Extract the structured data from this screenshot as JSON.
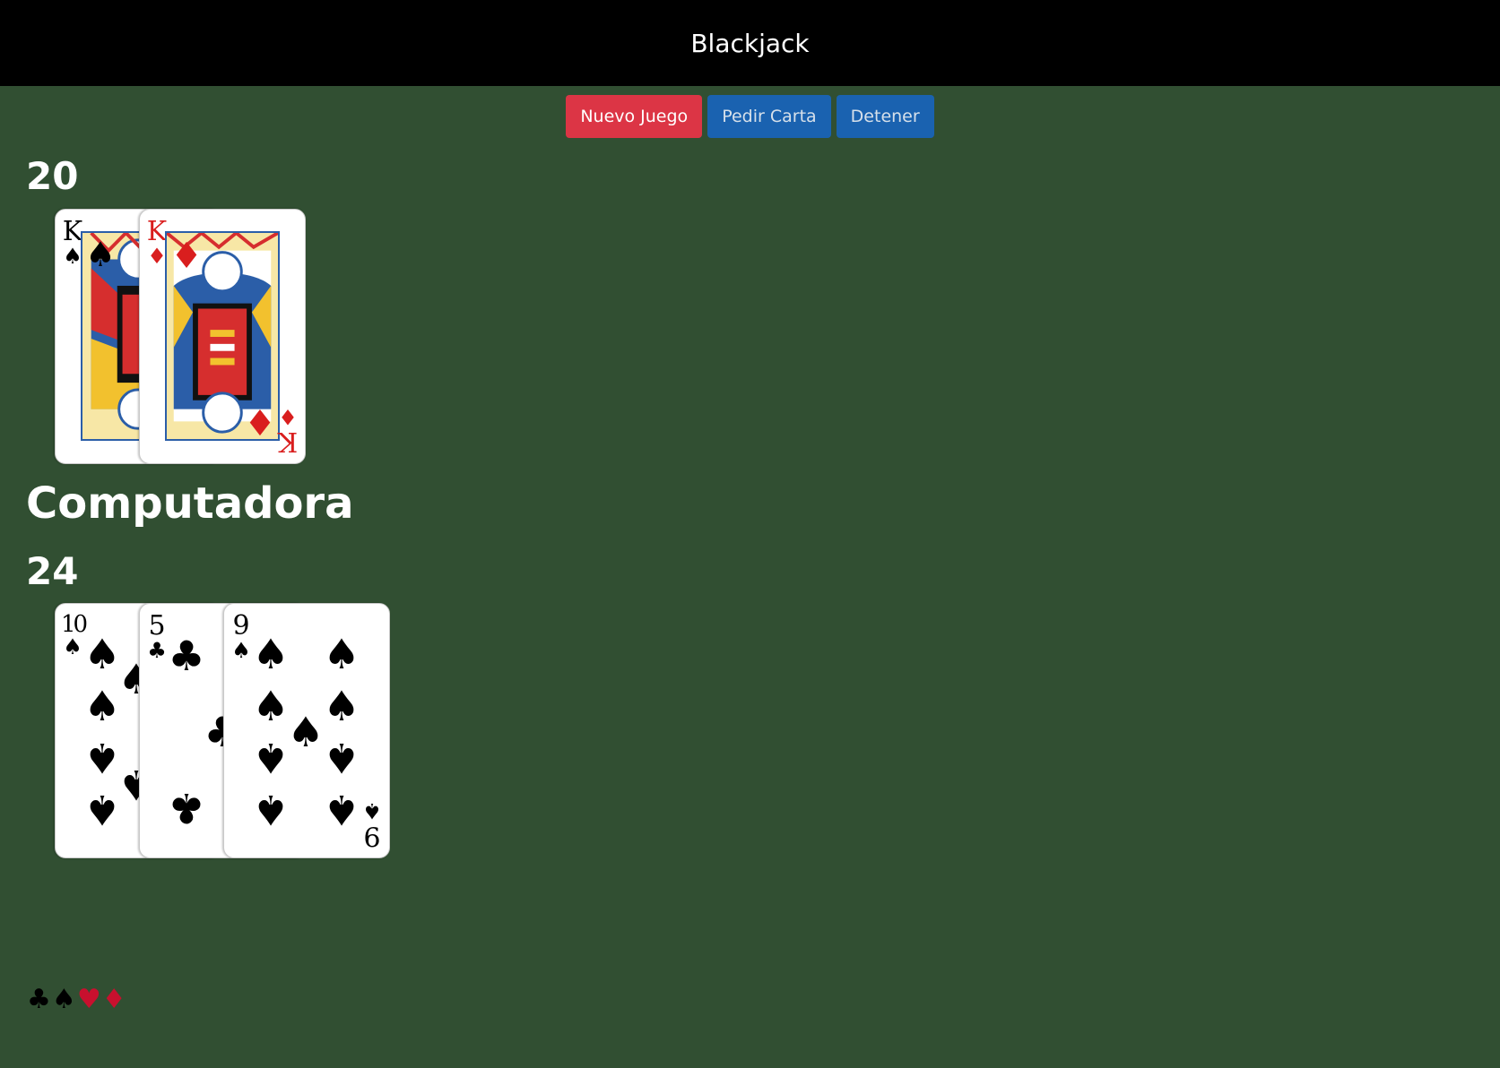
{
  "header": {
    "title": "Blackjack"
  },
  "controls": {
    "new_game": "Nuevo Juego",
    "hit": "Pedir Carta",
    "stand": "Detener"
  },
  "player": {
    "score": "20",
    "cards": [
      {
        "rank": "K",
        "suit": "♠",
        "color": "black"
      },
      {
        "rank": "K",
        "suit": "♦",
        "color": "red"
      }
    ]
  },
  "computer": {
    "title": "Computadora",
    "score": "24",
    "cards": [
      {
        "rank": "10",
        "suit": "♠",
        "color": "black"
      },
      {
        "rank": "5",
        "suit": "♣",
        "color": "black"
      },
      {
        "rank": "9",
        "suit": "♠",
        "color": "black"
      }
    ]
  },
  "footer": {
    "suits": [
      {
        "glyph": "♣",
        "color": "#000000"
      },
      {
        "glyph": "♠",
        "color": "#000000"
      },
      {
        "glyph": "♥",
        "color": "#c8102e"
      },
      {
        "glyph": "♦",
        "color": "#c8102e"
      }
    ]
  },
  "colors": {
    "table": "#314f32",
    "header": "#000000",
    "danger": "#dc3545",
    "primary": "#1a62b0"
  }
}
